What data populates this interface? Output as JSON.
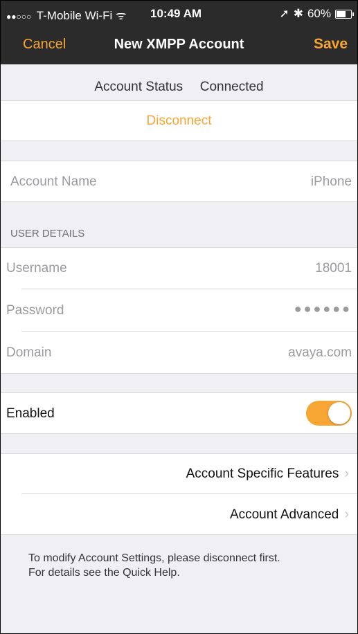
{
  "status_bar": {
    "signal_dots": "●●○○○",
    "carrier": "T-Mobile Wi-Fi",
    "wifi": "ᯤ",
    "time": "10:49 AM",
    "location": "➚",
    "bluetooth": "✱",
    "battery": "60%"
  },
  "nav": {
    "cancel": "Cancel",
    "title": "New XMPP Account",
    "save": "Save"
  },
  "account_status": {
    "label": "Account Status",
    "value": "Connected",
    "disconnect": "Disconnect"
  },
  "account_name": {
    "label": "Account Name",
    "value": "iPhone"
  },
  "user_details": {
    "header": "USER DETAILS",
    "username_label": "Username",
    "username_value": "18001",
    "password_label": "Password",
    "password_value": "●●●●●●",
    "domain_label": "Domain",
    "domain_value": "avaya.com"
  },
  "enabled": {
    "label": "Enabled",
    "on": true
  },
  "links": {
    "specific": "Account Specific Features",
    "advanced": "Account Advanced",
    "chevron": "›"
  },
  "footer": {
    "line1": "To modify Account Settings, please disconnect first.",
    "line2": "For details see the Quick Help."
  },
  "colors": {
    "accent": "#f7a533",
    "bar": "#2b2b2b"
  }
}
